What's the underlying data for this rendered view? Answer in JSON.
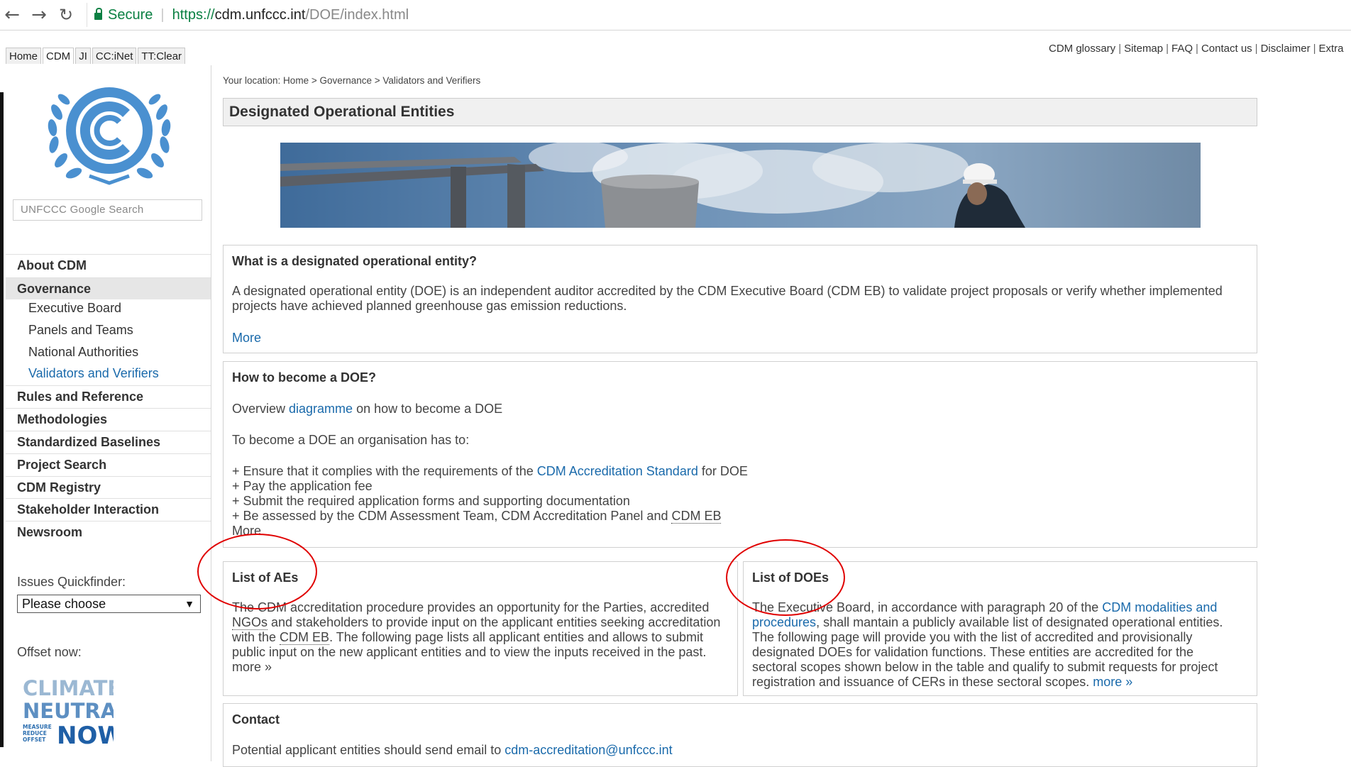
{
  "browser": {
    "secure_label": "Secure",
    "url_scheme": "https://",
    "url_host": "cdm.unfccc.int",
    "url_path": "/DOE/index.html",
    "icons": [
      "back-icon",
      "forward-icon",
      "reload-icon",
      "lock-icon"
    ]
  },
  "top_tabs": [
    "Home",
    "CDM",
    "JI",
    "CC:iNet",
    "TT:Clear"
  ],
  "util_links": [
    "CDM glossary",
    "Sitemap",
    "FAQ",
    "Contact us",
    "Disclaimer",
    "Extra"
  ],
  "sidebar": {
    "search_placeholder": "UNFCCC Google Search",
    "nav": {
      "about": "About CDM",
      "governance": "Governance",
      "sub": [
        "Executive Board",
        "Panels and Teams",
        "National Authorities",
        "Validators and Verifiers"
      ],
      "rules": "Rules and Reference",
      "methodologies": "Methodologies",
      "baselines": "Standardized Baselines",
      "project_search": "Project Search",
      "registry": "CDM Registry",
      "stakeholder": "Stakeholder Interaction",
      "newsroom": "Newsroom"
    },
    "issues_label": "Issues Quickfinder:",
    "issues_selected": "Please choose",
    "offset_label": "Offset now:",
    "climate_neutral": {
      "line1": "CLIMATE",
      "line2": "NEUTRAL",
      "small": [
        "MEASURE",
        "REDUCE",
        "OFFSET"
      ],
      "now": "NOW"
    }
  },
  "main": {
    "breadcrumb": "Your location: Home > Governance > Validators and Verifiers",
    "title": "Designated Operational Entities",
    "what": {
      "title": "What is a designated operational entity?",
      "line1": "A designated operational entity (DOE) is an independent auditor accredited by the CDM Executive Board (CDM EB) to validate project proposals or verify whether implemented",
      "line2": "projects have achieved planned greenhouse gas emission reductions.",
      "more": "More"
    },
    "how": {
      "title": "How to become a DOE?",
      "overview_pre": "Overview ",
      "overview_link": "diagramme",
      "overview_post": " on how to become a DOE",
      "intro": "To become a DOE an organisation has to:",
      "b1_pre": "+ Ensure that it complies with the requirements of the ",
      "b1_link": "CDM Accreditation Standard",
      "b1_post": " for DOE",
      "b2": "+ Pay the application fee",
      "b3": "+ Submit the required application forms and supporting documentation",
      "b4_pre": "+ Be assessed by the CDM Assessment Team, CDM Accreditation Panel and ",
      "b4_abbr": "CDM EB",
      "more": "More"
    },
    "aes": {
      "title": "List of AEs",
      "l1": "The CDM accreditation procedure provides an opportunity for the Parties, accredited",
      "l2_abbr": "NGOs",
      "l2_rest": " and stakeholders to provide input on the applicant entities seeking accreditation",
      "l3_pre": "with the ",
      "l3_abbr": "CDM EB",
      "l3_rest": ". The following page lists all applicant entities and allows to submit",
      "l4": "public input on the new applicant entities and to view the inputs received in the past.",
      "more": "more »"
    },
    "does": {
      "title": "List of DOEs",
      "l1_pre": "The Executive Board, in accordance with paragraph 20 of the ",
      "l1_link": "CDM modalities and",
      "l2_link": "procedures",
      "l2_rest": ", shall mantain a publicly available list of designated operational entities.",
      "l3": "The following page will provide you with the list of accredited and provisionally",
      "l4": "designated DOEs for validation functions. These entities are accredited for the",
      "l5": "sectoral scopes shown below in the table and qualify to submit requests for project",
      "l6_pre": "registration and issuance of CERs in these sectoral scopes. ",
      "l6_link": "more »"
    },
    "contact": {
      "title": "Contact",
      "text_pre": "Potential applicant entities should send email to ",
      "email": "cdm-accreditation@unfccc.int"
    }
  },
  "colors": {
    "link": "#1a6aab",
    "secure": "#0b8043",
    "logo_blue": "#4a90d0",
    "annotation_red": "#e00000",
    "panel_bg": "#f0f0f0"
  }
}
